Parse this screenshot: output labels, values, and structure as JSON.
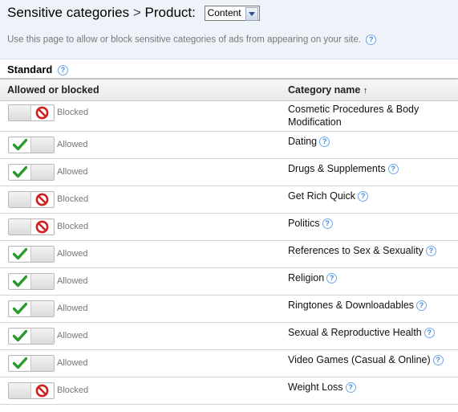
{
  "header": {
    "title": "Sensitive categories",
    "separator": ">",
    "product_label": "Product:",
    "product_select_value": "Content",
    "subtitle": "Use this page to allow or block sensitive categories of ads from appearing on your site."
  },
  "section": {
    "title": "Standard"
  },
  "table": {
    "col_status": "Allowed or blocked",
    "col_category": "Category name",
    "sort_indicator": "↑",
    "rows": [
      {
        "status": "Blocked",
        "category": "Cosmetic Procedures & Body Modification",
        "help": false
      },
      {
        "status": "Allowed",
        "category": "Dating",
        "help": true
      },
      {
        "status": "Allowed",
        "category": "Drugs & Supplements",
        "help": true
      },
      {
        "status": "Blocked",
        "category": "Get Rich Quick",
        "help": true
      },
      {
        "status": "Blocked",
        "category": "Politics",
        "help": true
      },
      {
        "status": "Allowed",
        "category": "References to Sex & Sexuality",
        "help": true
      },
      {
        "status": "Allowed",
        "category": "Religion",
        "help": true
      },
      {
        "status": "Allowed",
        "category": "Ringtones & Downloadables",
        "help": true
      },
      {
        "status": "Allowed",
        "category": "Sexual & Reproductive Health",
        "help": true
      },
      {
        "status": "Allowed",
        "category": "Video Games (Casual & Online)",
        "help": true
      },
      {
        "status": "Blocked",
        "category": "Weight Loss",
        "help": true
      }
    ]
  },
  "icons": {
    "help": "help-icon",
    "allowed": "checkmark-icon",
    "blocked": "no-entry-icon",
    "dropdown": "chevron-down-icon"
  },
  "colors": {
    "check": "#2a9a2a",
    "blocked": "#d21f1f",
    "help": "#3a86e0",
    "header_bg": "#eef3fa"
  }
}
